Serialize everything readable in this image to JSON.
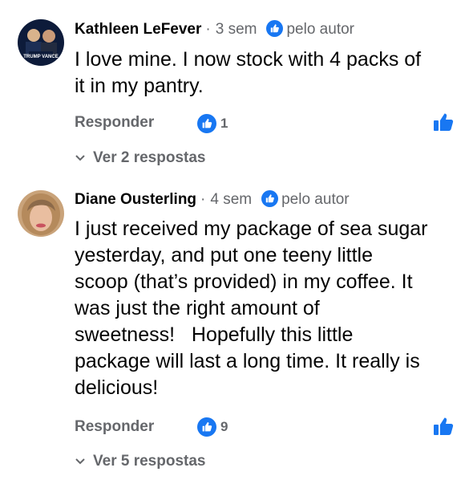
{
  "comments": [
    {
      "author": "Kathleen LeFever",
      "time": "3 sem",
      "author_badge": "pelo autor",
      "text_lines": [
        "I love mine. I now stock with 4 packs of",
        "it in my pantry."
      ],
      "reply_label": "Responder",
      "reaction_count": "1",
      "view_replies": "Ver 2 respostas",
      "avatar_text": "TRUMP VANCE"
    },
    {
      "author": "Diane Ousterling",
      "time": "4 sem",
      "author_badge": "pelo autor",
      "text_lines": [
        "I just received my package of sea sugar",
        "yesterday, and put one teeny little",
        "scoop (that’s provided) in my coffee. It",
        "was just the right amount of",
        "sweetness!   Hopefully this little",
        "package will last a long time. It really is",
        "delicious!"
      ],
      "reply_label": "Responder",
      "reaction_count": "9",
      "view_replies": "Ver 5 respostas"
    }
  ],
  "separator": "·",
  "colors": {
    "accent": "#1877f2",
    "secondary_text": "#65676b",
    "primary_text": "#050505"
  },
  "icons": [
    "like-reaction-icon",
    "like-button-icon",
    "author-badge-icon",
    "chevron-down-icon"
  ]
}
